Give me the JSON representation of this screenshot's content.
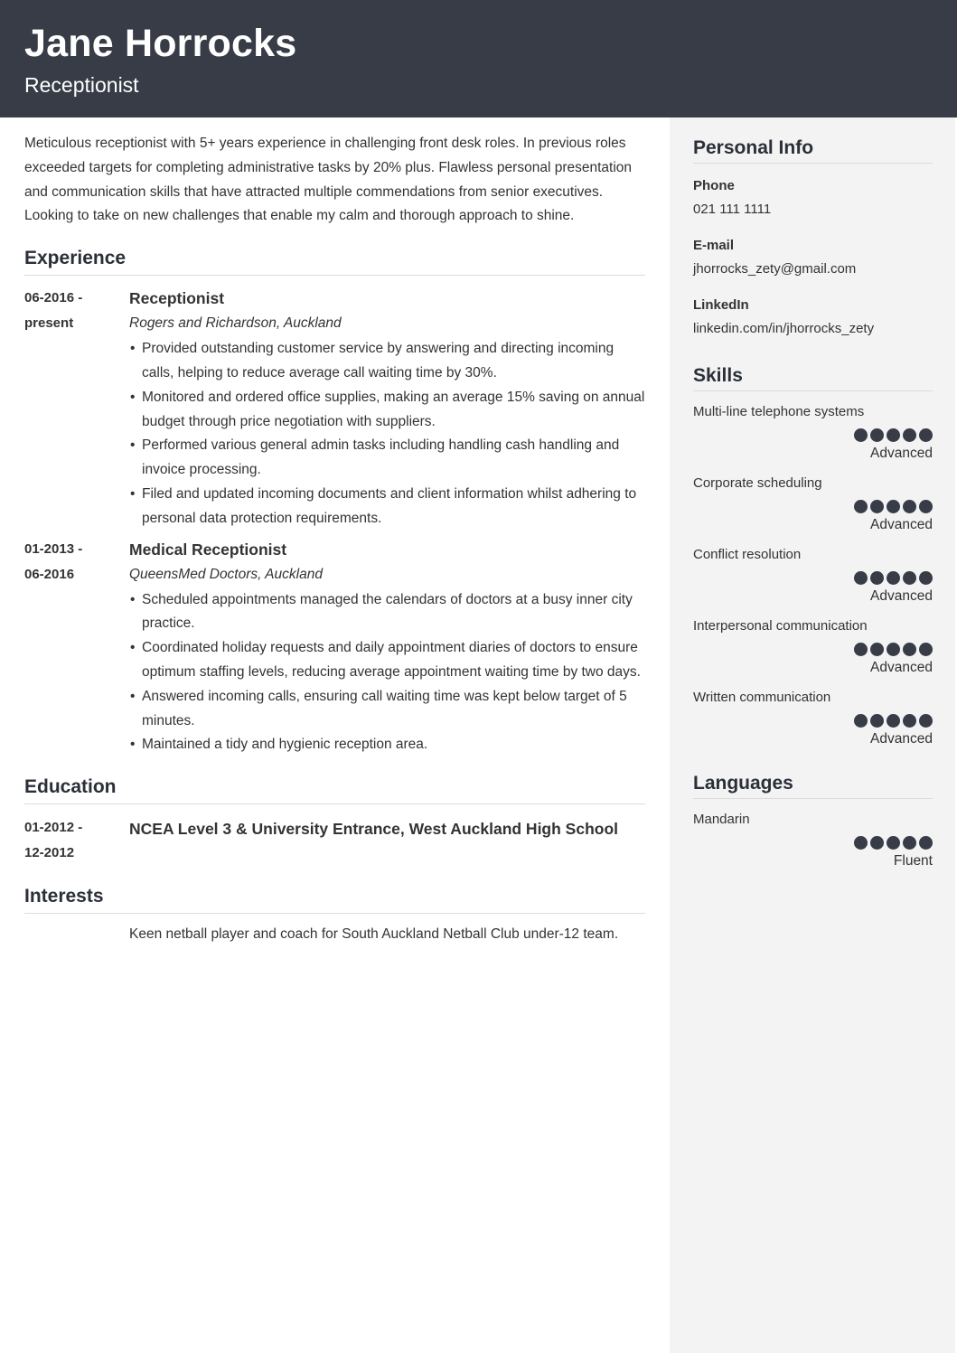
{
  "header": {
    "name": "Jane Horrocks",
    "role": "Receptionist"
  },
  "colors": {
    "header_bg": "#383c47",
    "sidebar_bg": "#f3f3f3",
    "rating_dot": "#383c47"
  },
  "summary": "Meticulous receptionist with 5+ years experience in challenging front desk roles. In previous roles exceeded targets for completing administrative tasks by 20% plus. Flawless personal presentation and communication skills that have attracted multiple commendations from senior executives. Looking to take on new challenges that enable my calm and thorough approach to shine.",
  "experience": {
    "title": "Experience",
    "entries": [
      {
        "date_start": "06-2016 -",
        "date_end": "present",
        "job_title": "Receptionist",
        "company": "Rogers and Richardson, Auckland",
        "bullets": [
          "Provided outstanding customer service by answering and directing incoming calls, helping to reduce average call waiting time by 30%.",
          "Monitored and ordered office supplies, making an average 15% saving on annual budget through price negotiation with suppliers.",
          "Performed various general admin tasks including handling cash handling and invoice processing.",
          "Filed and updated incoming documents and client information whilst adhering to personal data protection requirements."
        ]
      },
      {
        "date_start": "01-2013 -",
        "date_end": "06-2016",
        "job_title": "Medical Receptionist",
        "company": "QueensMed Doctors, Auckland",
        "bullets": [
          "Scheduled appointments managed the calendars of doctors at a busy inner city practice.",
          "Coordinated holiday requests and daily appointment diaries of doctors to ensure optimum staffing levels, reducing average appointment waiting time by two days.",
          "Answered incoming calls, ensuring call waiting time was kept below target of 5 minutes.",
          "Maintained a tidy and hygienic reception area."
        ]
      }
    ]
  },
  "education": {
    "title": "Education",
    "entries": [
      {
        "date_start": "01-2012 -",
        "date_end": "12-2012",
        "degree": "NCEA Level 3 & University Entrance, West Auckland High School"
      }
    ]
  },
  "interests": {
    "title": "Interests",
    "text": "Keen netball player and coach for South Auckland Netball Club under-12 team."
  },
  "personal_info": {
    "title": "Personal Info",
    "items": [
      {
        "label": "Phone",
        "value": "021 111 1111"
      },
      {
        "label": "E-mail",
        "value": "jhorrocks_zety@gmail.com"
      },
      {
        "label": "LinkedIn",
        "value": "linkedin.com/in/jhorrocks_zety"
      }
    ]
  },
  "skills": {
    "title": "Skills",
    "items": [
      {
        "name": "Multi-line telephone systems",
        "rating": 5,
        "max": 5,
        "level": "Advanced"
      },
      {
        "name": "Corporate scheduling",
        "rating": 5,
        "max": 5,
        "level": "Advanced"
      },
      {
        "name": "Conflict resolution",
        "rating": 5,
        "max": 5,
        "level": "Advanced"
      },
      {
        "name": "Interpersonal communication",
        "rating": 5,
        "max": 5,
        "level": "Advanced"
      },
      {
        "name": "Written communication",
        "rating": 5,
        "max": 5,
        "level": "Advanced"
      }
    ]
  },
  "languages": {
    "title": "Languages",
    "items": [
      {
        "name": "Mandarin",
        "rating": 5,
        "max": 5,
        "level": "Fluent"
      }
    ]
  }
}
